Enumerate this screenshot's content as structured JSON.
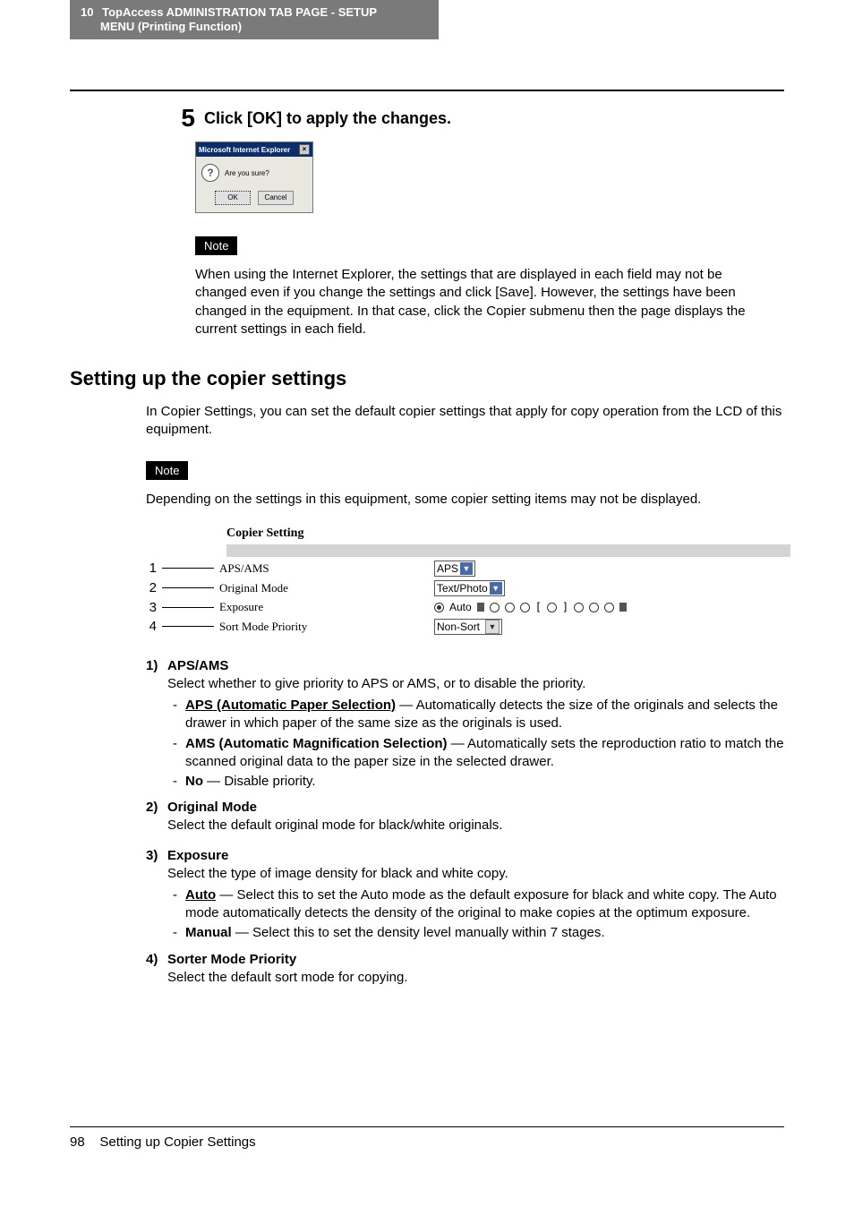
{
  "header": {
    "page_top": "10",
    "title_line1": "TopAccess ADMINISTRATION TAB PAGE - SETUP",
    "title_line2": "MENU (Printing Function)"
  },
  "step5": {
    "num": "5",
    "text": "Click [OK] to apply the changes."
  },
  "dialog": {
    "title": "Microsoft Internet Explorer",
    "message": "Are you sure?",
    "ok": "OK",
    "cancel": "Cancel"
  },
  "note_label": "Note",
  "note1_text": "When using the Internet Explorer, the settings that are displayed in each field may not be changed even if you change the settings and click [Save].  However, the settings have been changed in the equipment.  In that case, click the Copier submenu then the page displays the current settings in each field.",
  "section_heading": "Setting up the copier settings",
  "section_intro": "In Copier Settings, you can set the default copier settings that apply for copy operation from the LCD of this equipment.",
  "note2_text": "Depending on the settings in this equipment, some copier setting items may not be displayed.",
  "copier_fig": {
    "title": "Copier Setting",
    "rows": [
      {
        "idx": "1",
        "label": "APS/AMS",
        "value": "APS",
        "ctrl": "select_blue"
      },
      {
        "idx": "2",
        "label": "Original Mode",
        "value": "Text/Photo",
        "ctrl": "select_blue"
      },
      {
        "idx": "3",
        "label": "Exposure",
        "value": "Auto",
        "ctrl": "exposure"
      },
      {
        "idx": "4",
        "label": "Sort Mode Priority",
        "value": "Non-Sort",
        "ctrl": "select_grey"
      }
    ]
  },
  "defs": [
    {
      "num": "1)",
      "heading": "APS/AMS",
      "lead": "Select whether to give priority to APS or AMS, or to disable the priority.",
      "subs": [
        {
          "bold": "APS (Automatic Paper Selection)",
          "underline": true,
          "rest": " — Automatically detects the size of the originals and selects the drawer in which paper of the same size as the originals is used."
        },
        {
          "bold": "AMS (Automatic Magnification Selection)",
          "underline": false,
          "rest": " — Automatically sets the reproduction ratio to match the scanned original data to the paper size in the selected drawer."
        },
        {
          "bold": "No",
          "underline": false,
          "rest": " — Disable priority."
        }
      ]
    },
    {
      "num": "2)",
      "heading": "Original Mode",
      "lead": "Select the default original mode for black/white originals.",
      "subs": []
    },
    {
      "num": "3)",
      "heading": "Exposure",
      "lead": "Select the type of image density for black and white copy.",
      "subs": [
        {
          "bold": "Auto",
          "underline": true,
          "rest": " — Select this to set the Auto mode as the default exposure for black and white copy.  The Auto mode automatically detects the density of the original to make copies at the optimum exposure."
        },
        {
          "bold": "Manual",
          "underline": false,
          "rest": " — Select this to set the density level manually within 7 stages."
        }
      ]
    },
    {
      "num": "4)",
      "heading": "Sorter Mode Priority",
      "lead": "Select the default sort mode for copying.",
      "subs": []
    }
  ],
  "footer": {
    "page": "98",
    "title": "Setting up Copier Settings"
  }
}
